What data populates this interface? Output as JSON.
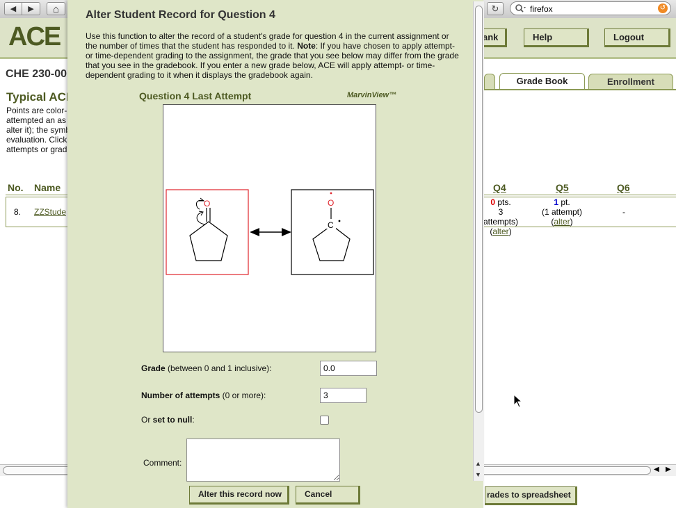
{
  "browser": {
    "back_glyph": "◀",
    "forward_glyph": "▶",
    "home_glyph": "⌂",
    "reload_glyph": "↻",
    "search_value": "firefox",
    "search_icon": "magnifier-icon"
  },
  "page": {
    "logo": "ACE",
    "top_buttons": [
      "ank",
      "Help",
      "Logout"
    ],
    "course": "CHE 230-00",
    "section_title": "Typical ACE",
    "description_lines": [
      "Points are color-",
      "attempted an as",
      "alter it); the symb",
      "evaluation. Click",
      "attempts or grad"
    ],
    "tabs": [
      "",
      "Grade Book",
      "Enrollment"
    ],
    "columns": {
      "no": "No.",
      "name": "Name",
      "q4": "Q4",
      "q5": "Q5",
      "q6": "Q6"
    },
    "row": {
      "no": "8.",
      "name": "ZZStude",
      "q4_pts": "0",
      "q4_unit": "pts.",
      "q4_attempts": "3 attempts)",
      "q5_pts": "1",
      "q5_unit": "pt.",
      "q5_attempts": "(1 attempt)",
      "q6": "-",
      "alter_link": "alter"
    },
    "export_button": "rades to spreadsheet",
    "colors": {
      "accent": "#4d5a22",
      "panel": "#dfe6c8",
      "zero_pts": "#dd0000",
      "one_pt": "#0000cc"
    }
  },
  "modal": {
    "title": "Alter Student Record for Question 4",
    "desc_part1": "Use this function to alter the record of a student's grade for question 4 in the current assignment or the number of times that the student has responded to it. ",
    "desc_note": "Note",
    "desc_part2": ": If you have chosen to apply attempt- or time-dependent grading to the assignment, the grade that you see below may differ from the grade that you see in the gradebook. If you enter a new grade below, ACE will apply attempt- or time-dependent grading to it when it displays the gradebook again.",
    "question_heading": "Question 4 Last Attempt",
    "viewer_brand": "MarvinView™",
    "molecule_atom": "O",
    "carbon_label": "C",
    "grade_label": "Grade",
    "grade_hint": " (between 0 and 1 inclusive):",
    "grade_value": "0.0",
    "attempts_label": "Number of attempts",
    "attempts_hint": " (0 or more):",
    "attempts_value": "3",
    "null_prefix": "Or ",
    "null_label": "set to null",
    "null_suffix": ":",
    "comment_label": "Comment:",
    "comment_value": "",
    "submit_button": "Alter this record now",
    "cancel_button": "Cancel"
  }
}
